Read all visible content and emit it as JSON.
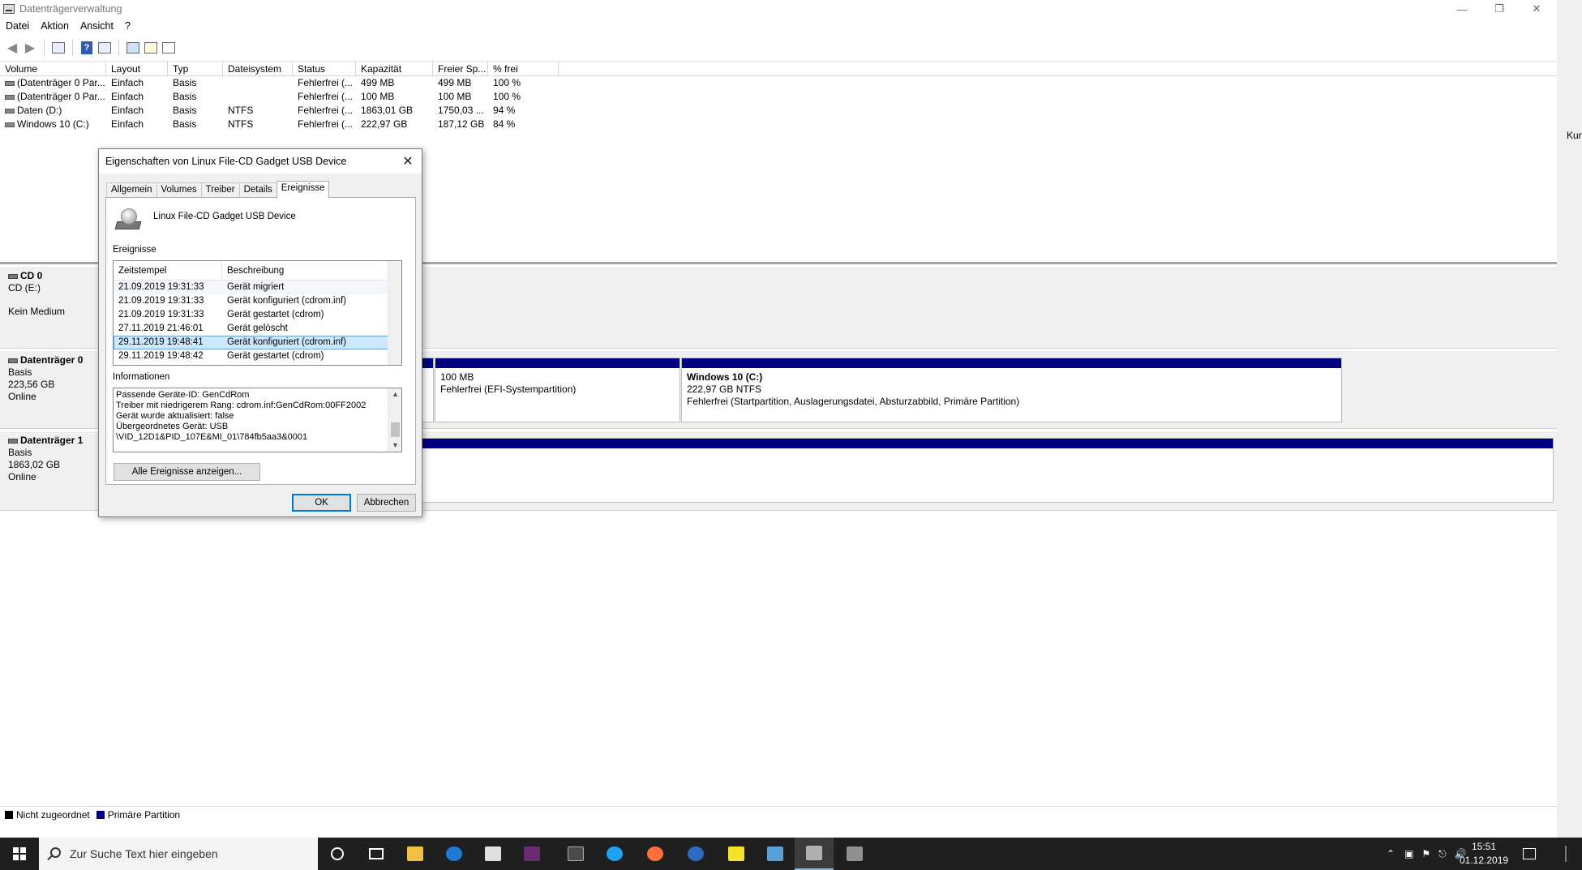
{
  "window": {
    "title": "Datenträgerverwaltung"
  },
  "menu": [
    "Datei",
    "Aktion",
    "Ansicht",
    "?"
  ],
  "volume_list": {
    "headers": [
      "Volume",
      "Layout",
      "Typ",
      "Dateisystem",
      "Status",
      "Kapazität",
      "Freier Sp...",
      "% frei"
    ],
    "rows": [
      [
        "(Datenträger 0 Par...",
        "Einfach",
        "Basis",
        "",
        "Fehlerfrei (...",
        "499 MB",
        "499 MB",
        "100 %"
      ],
      [
        "(Datenträger 0 Par...",
        "Einfach",
        "Basis",
        "",
        "Fehlerfrei (...",
        "100 MB",
        "100 MB",
        "100 %"
      ],
      [
        "Daten (D:)",
        "Einfach",
        "Basis",
        "NTFS",
        "Fehlerfrei (...",
        "1863,01 GB",
        "1750,03 ...",
        "94 %"
      ],
      [
        "Windows 10 (C:)",
        "Einfach",
        "Basis",
        "NTFS",
        "Fehlerfrei (...",
        "222,97 GB",
        "187,12 GB",
        "84 %"
      ]
    ]
  },
  "disks": {
    "cd0": {
      "name": "CD 0",
      "line1": "CD (E:)",
      "line2": "Kein Medium"
    },
    "disk0": {
      "name": "Datenträger 0",
      "type": "Basis",
      "size": "223,56 GB",
      "status": "Online",
      "efi": {
        "size": "100 MB",
        "status": "Fehlerfrei (EFI-Systempartition)"
      },
      "win": {
        "name": "Windows 10  (C:)",
        "size": "222,97 GB NTFS",
        "status": "Fehlerfrei (Startpartition, Auslagerungsdatei, Absturzabbild, Primäre Partition)"
      }
    },
    "disk1": {
      "name": "Datenträger 1",
      "type": "Basis",
      "size": "1863,02 GB",
      "status": "Online"
    }
  },
  "legend": {
    "unallocated": "Nicht zugeordnet",
    "primary": "Primäre Partition",
    "unallocated_color": "#000000",
    "primary_color": "#000080"
  },
  "right_edge_text": "Kun",
  "dialog": {
    "title": "Eigenschaften von Linux File-CD Gadget USB Device",
    "tabs": [
      "Allgemein",
      "Volumes",
      "Treiber",
      "Details",
      "Ereignisse"
    ],
    "active_tab": "Ereignisse",
    "device_name": "Linux File-CD Gadget USB Device",
    "events_label": "Ereignisse",
    "events_headers": [
      "Zeitstempel",
      "Beschreibung"
    ],
    "events": [
      {
        "ts": "21.09.2019 19:31:33",
        "desc": "Gerät migriert"
      },
      {
        "ts": "21.09.2019 19:31:33",
        "desc": "Gerät konfiguriert (cdrom.inf)"
      },
      {
        "ts": "21.09.2019 19:31:33",
        "desc": "Gerät gestartet (cdrom)"
      },
      {
        "ts": "27.11.2019 21:46:01",
        "desc": "Gerät gelöscht"
      },
      {
        "ts": "29.11.2019 19:48:41",
        "desc": "Gerät konfiguriert (cdrom.inf)"
      },
      {
        "ts": "29.11.2019 19:48:42",
        "desc": "Gerät gestartet (cdrom)"
      }
    ],
    "info_label": "Informationen",
    "info_lines": [
      "Passende Geräte-ID: GenCdRom",
      "Treiber mit niedrigerem Rang: cdrom.inf:GenCdRom:00FF2002",
      "Gerät wurde aktualisiert: false",
      "Übergeordnetes Gerät: USB",
      "\\VID_12D1&PID_107E&MI_01\\784fb5aa3&0001"
    ],
    "show_all_button": "Alle Ereignisse anzeigen...",
    "ok_button": "OK",
    "cancel_button": "Abbrechen"
  },
  "taskbar": {
    "search_placeholder": "Zur Suche Text hier eingeben",
    "time": "15:51",
    "date": "01.12.2019"
  }
}
